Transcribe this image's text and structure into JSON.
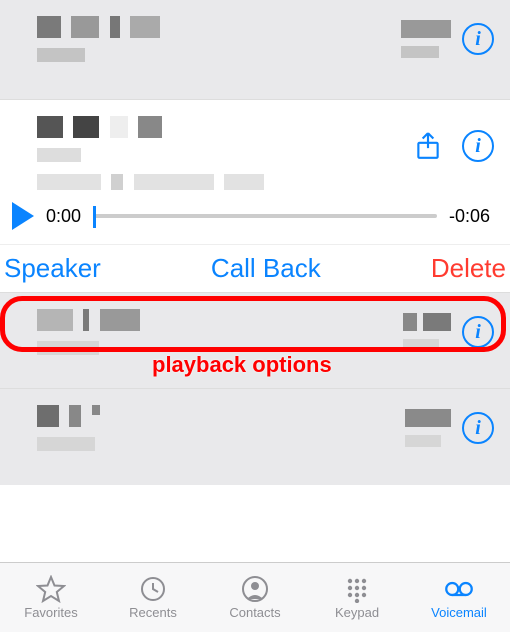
{
  "expanded": {
    "share_icon": "share-icon",
    "info_icon": "info-icon",
    "playback": {
      "current_time": "0:00",
      "remaining_time": "-0:06"
    },
    "controls": {
      "speaker": "Speaker",
      "callback": "Call Back",
      "delete": "Delete"
    }
  },
  "annotation": {
    "label": "playback options"
  },
  "tabs": {
    "favorites": "Favorites",
    "recents": "Recents",
    "contacts": "Contacts",
    "keypad": "Keypad",
    "voicemail": "Voicemail"
  },
  "info_glyph": "i"
}
